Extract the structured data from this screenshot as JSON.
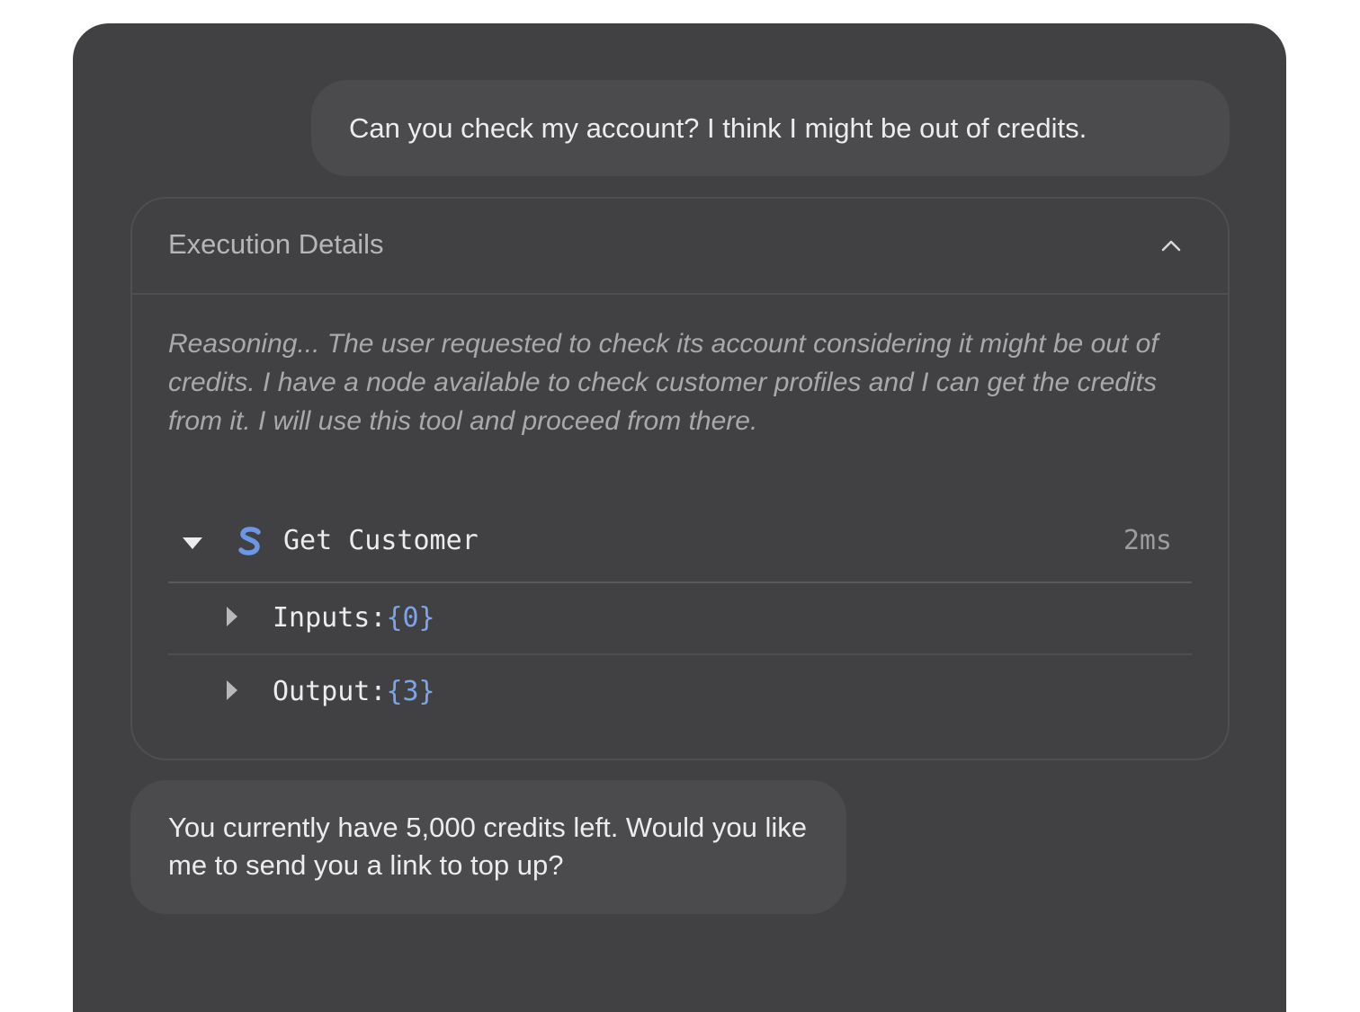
{
  "chat": {
    "user_message": "Can you check my account? I think I might be out of credits.",
    "assistant_message": "You currently have 5,000 credits left. Would you like me to send you a link to top up?"
  },
  "execution": {
    "title": "Execution Details",
    "reasoning": "Reasoning... The user requested to check its account considering it might be out of credits. I have a node available to check customer profiles and I can get the credits from it. I will use this tool and proceed from there.",
    "tool": {
      "name": "Get Customer",
      "duration": "2ms",
      "logo_icon": "s-logo-icon",
      "logo_color": "#6b97e6",
      "inputs_label": "Inputs:",
      "inputs_count": "{0}",
      "output_label": "Output:",
      "output_count": "{3}"
    }
  },
  "colors": {
    "panel": "#414143",
    "bubble": "#4b4b4d",
    "accent": "#7ea4e8"
  }
}
